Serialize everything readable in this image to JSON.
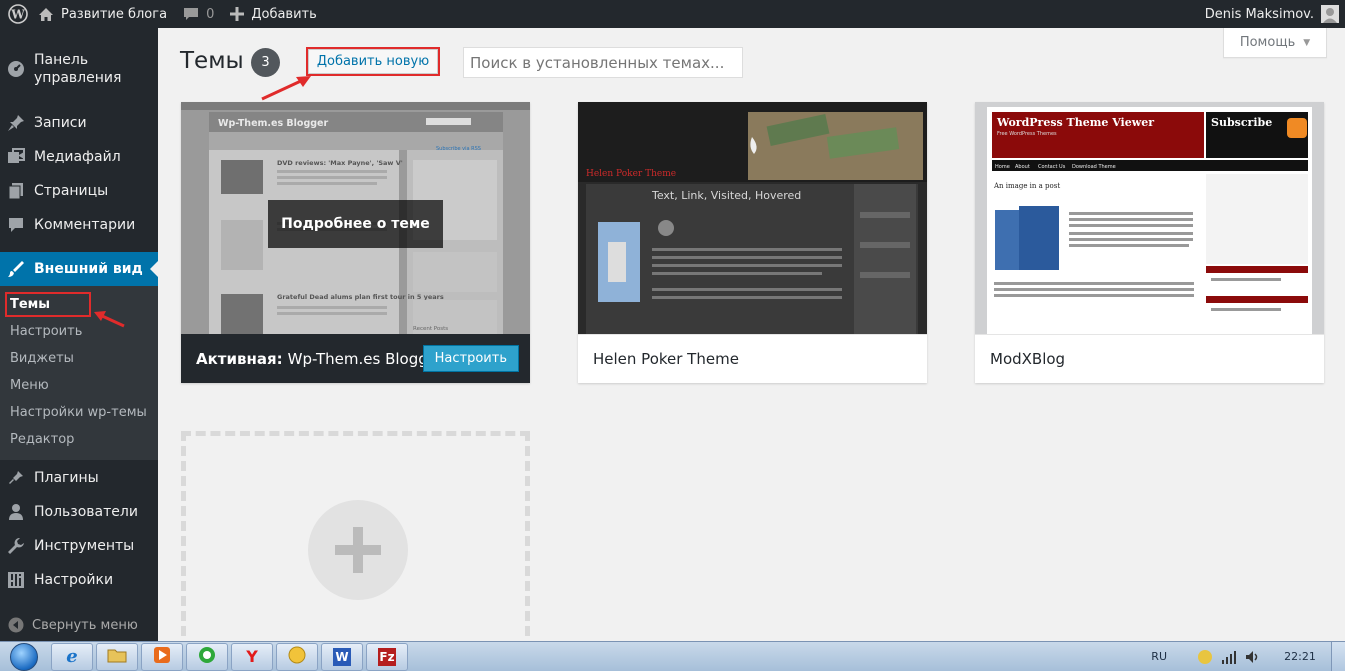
{
  "adminbar": {
    "site_name": "Развитие блога",
    "comments_count": "0",
    "add_label": "Добавить",
    "user_name": "Denis Maksimov."
  },
  "sidebar": {
    "items": [
      {
        "label": "Панель управления",
        "icon": "dashboard-icon"
      },
      {
        "label": "Записи",
        "icon": "pin-icon"
      },
      {
        "label": "Медиафайл",
        "icon": "media-icon"
      },
      {
        "label": "Страницы",
        "icon": "pages-icon"
      },
      {
        "label": "Комментарии",
        "icon": "comments-icon"
      },
      {
        "label": "Внешний вид",
        "icon": "appearance-icon"
      },
      {
        "label": "Плагины",
        "icon": "plugins-icon"
      },
      {
        "label": "Пользователи",
        "icon": "users-icon"
      },
      {
        "label": "Инструменты",
        "icon": "tools-icon"
      },
      {
        "label": "Настройки",
        "icon": "settings-icon"
      }
    ],
    "submenu": [
      "Темы",
      "Настроить",
      "Виджеты",
      "Меню",
      "Настройки wp-темы",
      "Редактор"
    ],
    "collapse_label": "Свернуть меню"
  },
  "main": {
    "title": "Темы",
    "count": "3",
    "add_new_label": "Добавить новую",
    "search_placeholder": "Поиск в установленных темах...",
    "help_label": "Помощь"
  },
  "themes": {
    "active": {
      "prefix": "Активная:",
      "name": "Wp-Them.es Blogger",
      "customize_label": "Настроить",
      "details_label": "Подробнее о теме",
      "screenshot": {
        "site_title": "Wp-Them.es Blogger",
        "post1": "DVD reviews: 'Max Payne', 'Saw V'",
        "post2": "Grateful Dead alums plan first tour in 5 years",
        "subscribe": "Subscribe via RSS",
        "recent": "Recent Posts"
      }
    },
    "second": {
      "name": "Helen Poker Theme",
      "screenshot": {
        "header": "Helen Poker Theme",
        "post": "Text, Link, Visited, Hovered"
      }
    },
    "third": {
      "name": "ModXBlog",
      "screenshot": {
        "header": "WordPress Theme Viewer",
        "tagline": "Free WordPress Themes",
        "subscribe": "Subscribe",
        "post_title": "An image in a post",
        "nav": [
          "Home",
          "About",
          "Contact Us",
          "Download Theme"
        ]
      }
    }
  },
  "taskbar": {
    "lang": "RU",
    "time": "22:21"
  },
  "colors": {
    "admin_dark": "#23282d",
    "accent_blue": "#0073aa",
    "highlight_red": "#e02b2b"
  }
}
